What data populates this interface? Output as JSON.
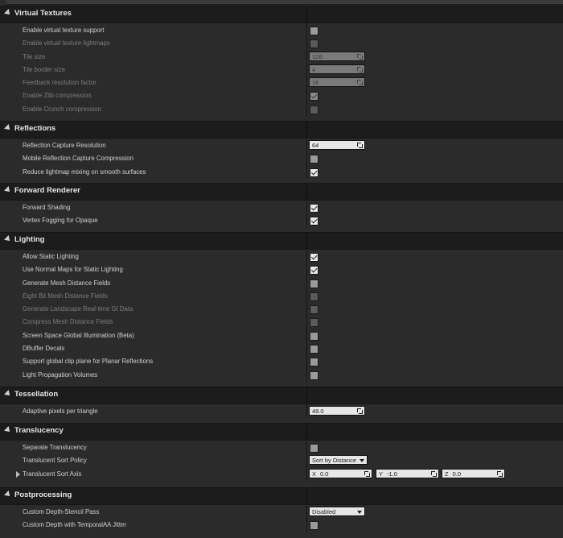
{
  "sections": {
    "virtual_textures": {
      "title": "Virtual Textures",
      "rows": {
        "enable_vt": "Enable virtual texture support",
        "enable_vt_lightmaps": "Enable virtual texture lightmaps",
        "tile_size": "Tile size",
        "tile_size_value": "128",
        "tile_border": "Tile border size",
        "tile_border_value": "4",
        "feedback": "Feedback resolution factor",
        "feedback_value": "16",
        "zlib": "Enable Zlib compression",
        "crunch": "Enable Crunch compression"
      }
    },
    "reflections": {
      "title": "Reflections",
      "rows": {
        "capture_res": "Reflection Capture Resolution",
        "capture_res_value": "64",
        "mobile_compression": "Mobile Reflection Capture Compression",
        "reduce_lightmap": "Reduce lightmap mixing on smooth surfaces"
      }
    },
    "forward_renderer": {
      "title": "Forward Renderer",
      "rows": {
        "forward_shading": "Forward Shading",
        "vertex_fogging": "Vertex Fogging for Opaque"
      }
    },
    "lighting": {
      "title": "Lighting",
      "rows": {
        "allow_static": "Allow Static Lighting",
        "normal_maps": "Use Normal Maps for Static Lighting",
        "mesh_df": "Generate Mesh Distance Fields",
        "eight_bit": "Eight Bit Mesh Distance Fields",
        "landscape_gi": "Generate Landscape Real-time GI Data",
        "compress_df": "Compress Mesh Distance Fields",
        "ssgi": "Screen Space Global Illumination (Beta)",
        "dbuffer": "DBuffer Decals",
        "clip_plane": "Support global clip plane for Planar Reflections",
        "lpv": "Light Propagation Volumes"
      }
    },
    "tessellation": {
      "title": "Tessellation",
      "rows": {
        "adaptive": "Adaptive pixels per triangle",
        "adaptive_value": "48.0"
      }
    },
    "translucency": {
      "title": "Translucency",
      "rows": {
        "separate": "Separate Translucency",
        "sort_policy": "Translucent Sort Policy",
        "sort_policy_value": "Sort by Distance",
        "sort_axis": "Translucent Sort Axis",
        "axis_x_label": "X",
        "axis_x_value": "0.0",
        "axis_y_label": "Y",
        "axis_y_value": "-1.0",
        "axis_z_label": "Z",
        "axis_z_value": "0.0"
      }
    },
    "postprocessing": {
      "title": "Postprocessing",
      "rows": {
        "custom_depth": "Custom Depth-Stencil Pass",
        "custom_depth_value": "Disabled",
        "custom_depth_taa": "Custom Depth with TemporalAA Jitter"
      }
    }
  },
  "checkbox_states": {
    "enable_vt": false,
    "enable_vt_lightmaps": false,
    "zlib": true,
    "crunch": false,
    "mobile_compression": false,
    "reduce_lightmap": true,
    "forward_shading": true,
    "vertex_fogging": true,
    "allow_static": true,
    "normal_maps": true,
    "mesh_df": false,
    "eight_bit": false,
    "landscape_gi": false,
    "compress_df": false,
    "ssgi": false,
    "dbuffer": false,
    "clip_plane": false,
    "lpv": false,
    "separate": false,
    "custom_depth_taa": false
  },
  "colors": {
    "header_bg": "#1c1c1c",
    "row_bg": "#2b2b2b",
    "text": "#d0d0d0",
    "disabled_text": "#7d7d7d"
  }
}
